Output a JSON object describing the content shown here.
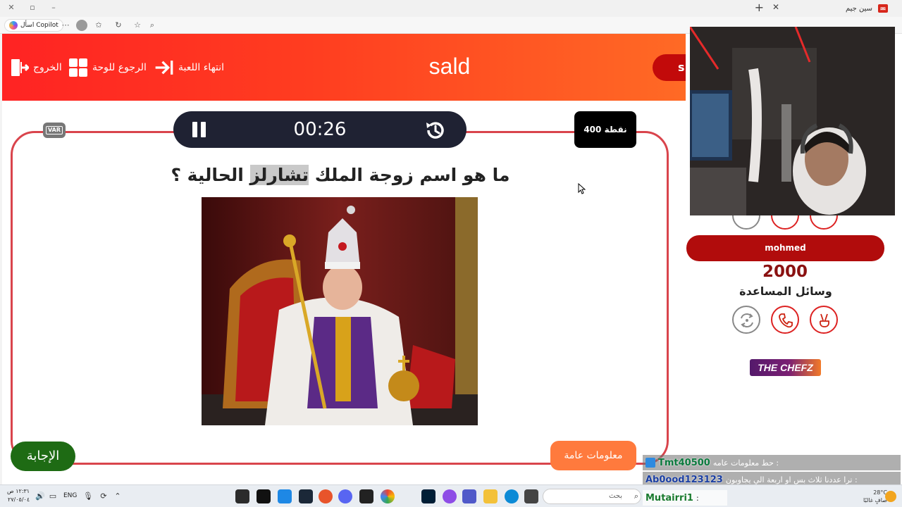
{
  "browser": {
    "tab_title": "سين جيم",
    "copilot_label": "اسأل Copilot"
  },
  "game": {
    "team_title": "sald",
    "header_buttons": {
      "end_game": "انتهاء اللعبة",
      "back_to_board": "الرجوع للوحة",
      "exit": "الخروج"
    },
    "other_team_initial": "s",
    "timer": "00:26",
    "points": "400 نقطة",
    "var_label": "VAR",
    "question_before": "ما هو اسم زوجة الملك ",
    "question_highlight": "تشارلز",
    "question_after": " الحالية ؟",
    "answer_button": "الإجابة",
    "category": "معلومات عامة"
  },
  "team_panel": {
    "team_name": "mohmed",
    "score": "2000",
    "helpers_label": "وسائل المساعدة",
    "sponsor": "THE CHEFZ"
  },
  "chat": [
    {
      "user": "Tmt40500",
      "message": "حط معلومات عامه :"
    },
    {
      "user": "Ab0ood123123",
      "message": "ترا عددنا ثلاث بس او اربعة الي يجاوبون :"
    },
    {
      "user": "Mutairri1",
      "message": ":"
    }
  ],
  "taskbar": {
    "time": "١٢:٣١ ص",
    "date": "٢٧/٠٥/٠٤",
    "language": "ENG",
    "search_placeholder": "بحث",
    "weather_temp": "28°C",
    "weather_desc": "صافٍ غالبًا"
  },
  "colors": {
    "header_start": "#ff2323",
    "header_end": "#ff6a25",
    "timer_bg": "#1f2233",
    "answer_bg": "#1e6b14",
    "category_bg": "#ff7a3d",
    "team_pill": "#b10c0c"
  }
}
